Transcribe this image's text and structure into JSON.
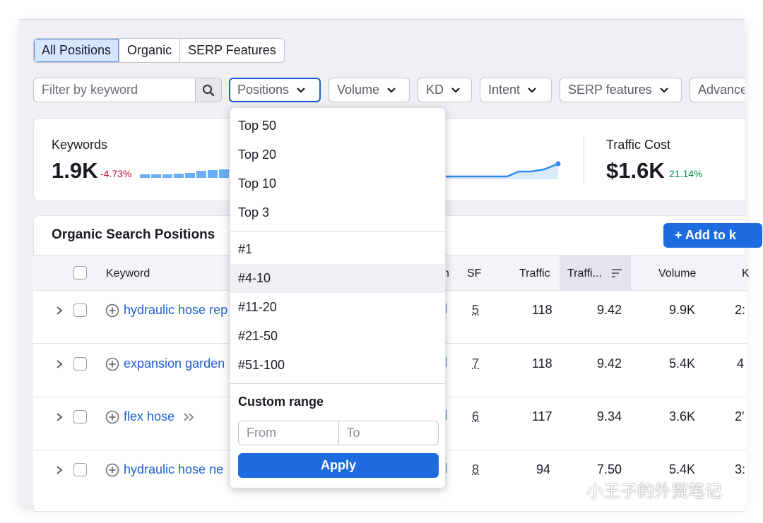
{
  "tabs": [
    "All Positions",
    "Organic",
    "SERP Features"
  ],
  "filter_placeholder": "Filter by keyword",
  "filters": [
    "Positions",
    "Volume",
    "KD",
    "Intent",
    "SERP features",
    "Advance"
  ],
  "kpis": {
    "keywords": {
      "label": "Keywords",
      "value": "1.9K",
      "change": "-4.73%"
    },
    "traffic_cost": {
      "label": "Traffic Cost",
      "value": "$1.6K",
      "change": "21.14%"
    }
  },
  "section_title": "Organic Search Positions",
  "add_button": "+ Add to k",
  "columns": {
    "keyword": "Keyword",
    "pos": "n",
    "sf": "SF",
    "traffic": "Traffic",
    "traffic_pct": "Traffi...",
    "volume": "Volume",
    "kd": "K"
  },
  "rows": [
    {
      "keyword": "hydraulic hose rep",
      "sf": "5",
      "traffic": "118",
      "traffic_pct": "9.42",
      "volume": "9.9K",
      "kd": "2:"
    },
    {
      "keyword": "expansion garden",
      "sf": "7",
      "traffic": "118",
      "traffic_pct": "9.42",
      "volume": "5.4K",
      "kd": "4"
    },
    {
      "keyword": "flex hose",
      "sf": "6",
      "traffic": "117",
      "traffic_pct": "9.34",
      "volume": "3.6K",
      "kd": "2'"
    },
    {
      "keyword": "hydraulic hose ne",
      "sf": "8",
      "traffic": "94",
      "traffic_pct": "7.50",
      "volume": "5.4K",
      "kd": "3:"
    }
  ],
  "menu": {
    "items_top": [
      "Top 50",
      "Top 20",
      "Top 10",
      "Top 3"
    ],
    "items_range": [
      "#1",
      "#4-10",
      "#11-20",
      "#21-50",
      "#51-100"
    ],
    "custom_title": "Custom range",
    "from_placeholder": "From",
    "to_placeholder": "To",
    "apply_label": "Apply"
  },
  "watermark": "小王子的外贸笔记",
  "colors": {
    "accent": "#1e6be0",
    "negative": "#c8102e",
    "positive": "#008a46"
  }
}
